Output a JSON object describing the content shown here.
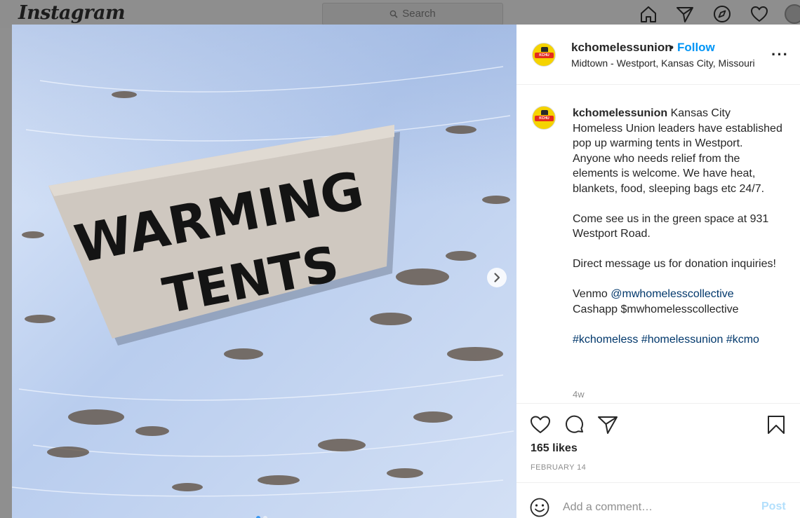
{
  "topbar": {
    "logo": "Instagram",
    "search_placeholder": "Search",
    "icons": [
      "home-icon",
      "direct-icon",
      "explore-icon",
      "activity-icon"
    ]
  },
  "photo": {
    "sign_line1": "WARMING",
    "sign_line2": "TENTS",
    "carousel_total": 2,
    "carousel_active": 1
  },
  "post": {
    "username": "kchomelessunion",
    "follow_label": "Follow",
    "location": "Midtown - Westport, Kansas City, Missouri",
    "avatar_text": "KCHU",
    "caption_p1": "Kansas City Homeless Union leaders have established pop up warming tents in Westport. Anyone who needs relief from the elements is welcome. We have heat, blankets, food, sleeping bags etc 24/7.",
    "caption_p2": "Come see us in the green space at 931 Westport Road.",
    "caption_p3": "Direct message us for donation inquiries!",
    "venmo_label": "Venmo",
    "venmo_handle": "@mwhomelesscollective",
    "cashapp_line": "Cashapp $mwhomelesscollective",
    "hashtags": [
      "#kchomeless",
      "#homelessunion",
      "#kcmo"
    ],
    "age": "4w",
    "likes": "165 likes",
    "date": "FEBRUARY 14",
    "comment_placeholder": "Add a comment…",
    "post_label": "Post"
  },
  "colors": {
    "accent": "#0095f6",
    "post_disabled": "#b2dffc",
    "link": "#00376b",
    "muted": "#8e8e8e"
  }
}
